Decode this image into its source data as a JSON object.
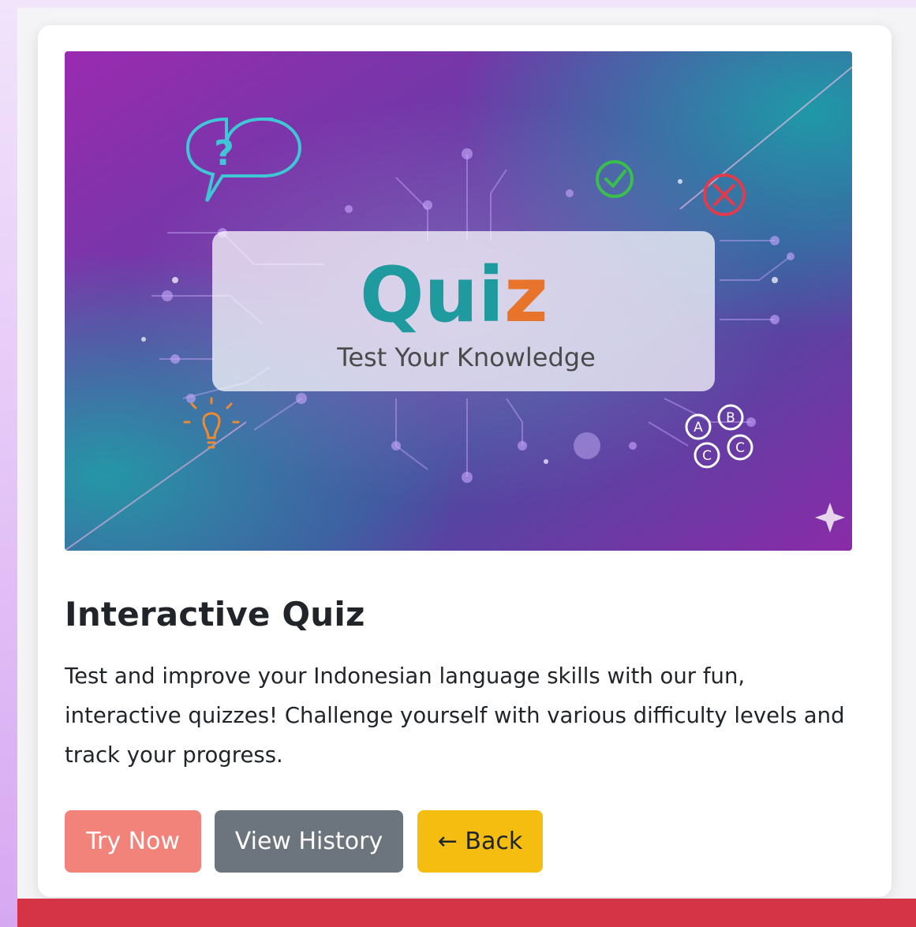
{
  "hero": {
    "heading": "Quiz",
    "heading_main": "Qui",
    "heading_accent": "z",
    "subheading": "Test Your Knowledge",
    "choice_labels": [
      "A",
      "B",
      "C",
      "C"
    ],
    "colors": {
      "heading": "#1f9a9e",
      "accent": "#e8742b",
      "check": "#3bbf4c",
      "cross": "#e23b4b",
      "bubble": "#3fc7d6",
      "bulb": "#f08a2e"
    }
  },
  "content": {
    "title": "Interactive Quiz",
    "description": "Test and improve your Indonesian language skills with our fun, interactive quizzes! Challenge yourself with various difficulty levels and track your progress."
  },
  "actions": {
    "try_now": "Try Now",
    "view_history": "View History",
    "back": "← Back"
  },
  "theme": {
    "try_color": "#f1837a",
    "history_color": "#6c757d",
    "back_color": "#f5bd0f",
    "footer_color": "#d53446"
  }
}
